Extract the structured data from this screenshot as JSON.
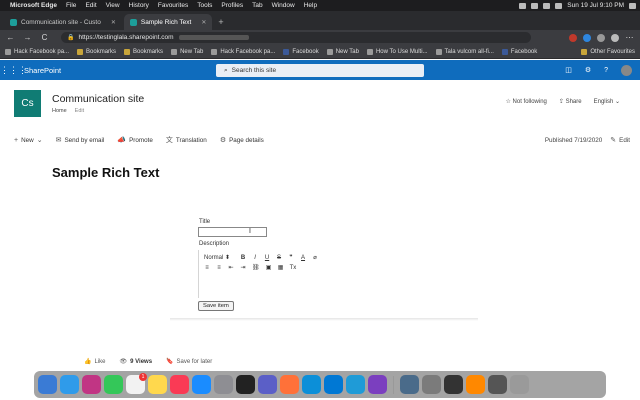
{
  "menubar": {
    "apple": "",
    "items": [
      "Microsoft Edge",
      "File",
      "Edit",
      "View",
      "History",
      "Favourites",
      "Tools",
      "Profiles",
      "Tab",
      "Window",
      "Help"
    ],
    "clock": "Sun 19 Jul  9:10 PM"
  },
  "tabs": [
    {
      "title": "Communication site - Custo",
      "active": false
    },
    {
      "title": "Sample Rich Text",
      "active": true
    }
  ],
  "new_tab": "+",
  "address": {
    "back": "←",
    "forward": "→",
    "reload": "C",
    "url": "https://testinglala.sharepoint.com"
  },
  "bookmarks": [
    {
      "label": "Hack Facebook pa...",
      "icon": "page-icon"
    },
    {
      "label": "Bookmarks",
      "icon": "folder-icon"
    },
    {
      "label": "Bookmarks",
      "icon": "folder-icon"
    },
    {
      "label": "New Tab",
      "icon": "page-icon"
    },
    {
      "label": "Hack Facebook pa...",
      "icon": "page-icon"
    },
    {
      "label": "Facebook",
      "icon": "facebook-icon"
    },
    {
      "label": "New Tab",
      "icon": "page-icon"
    },
    {
      "label": "How To Use Multi...",
      "icon": "page-icon"
    },
    {
      "label": "Tala vulcom all-fi...",
      "icon": "page-icon"
    },
    {
      "label": "Facebook",
      "icon": "facebook-icon"
    }
  ],
  "other_favourites": "Other Favourites",
  "suitebar": {
    "app_name": "SharePoint",
    "search_placeholder": "Search this site"
  },
  "site": {
    "logo": "Cs",
    "title": "Communication site",
    "nav_home": "Home",
    "nav_edit": "Edit",
    "not_following": "Not following",
    "share": "Share",
    "language": "English"
  },
  "commands": {
    "new": "New",
    "send_by_email": "Send by email",
    "promote": "Promote",
    "translation": "Translation",
    "page_details": "Page details",
    "published": "Published 7/19/2020",
    "edit": "Edit"
  },
  "page": {
    "title": "Sample Rich Text"
  },
  "form": {
    "title_label": "Title",
    "title_value": "",
    "description_label": "Description",
    "format_select": "Normal",
    "toolbar_row1": [
      "B",
      "I",
      "U",
      "S",
      "❞",
      "A",
      "⌀"
    ],
    "toolbar_row2": [
      "≡",
      "≡",
      "⇤",
      "⇥",
      "⛓",
      "▣",
      "▦",
      "Tx"
    ],
    "save_label": "Save item"
  },
  "footer": {
    "like": "Like",
    "views": "9 Views",
    "save_for_later": "Save for later"
  },
  "dock": {
    "calendar_badge": "1"
  },
  "colors": {
    "suite_bar": "#0f6cbd",
    "site_logo": "#107c74"
  }
}
